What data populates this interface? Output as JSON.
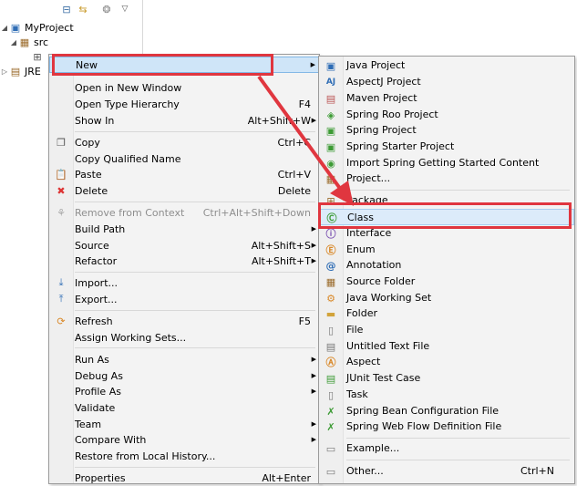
{
  "explorer": {
    "project": "MyProject",
    "src": "src",
    "jre": "JRE"
  },
  "menu": {
    "new": {
      "label": "New"
    },
    "open_new_window": {
      "label": "Open in New Window"
    },
    "open_type_hierarchy": {
      "label": "Open Type Hierarchy",
      "shortcut": "F4"
    },
    "show_in": {
      "label": "Show In",
      "shortcut": "Alt+Shift+W"
    },
    "copy": {
      "label": "Copy",
      "shortcut": "Ctrl+C"
    },
    "copy_qualified": {
      "label": "Copy Qualified Name"
    },
    "paste": {
      "label": "Paste",
      "shortcut": "Ctrl+V"
    },
    "delete": {
      "label": "Delete",
      "shortcut": "Delete"
    },
    "remove_context": {
      "label": "Remove from Context",
      "shortcut": "Ctrl+Alt+Shift+Down"
    },
    "build_path": {
      "label": "Build Path"
    },
    "source": {
      "label": "Source",
      "shortcut": "Alt+Shift+S"
    },
    "refactor": {
      "label": "Refactor",
      "shortcut": "Alt+Shift+T"
    },
    "import": {
      "label": "Import..."
    },
    "export": {
      "label": "Export..."
    },
    "refresh": {
      "label": "Refresh",
      "shortcut": "F5"
    },
    "assign_working_sets": {
      "label": "Assign Working Sets..."
    },
    "run_as": {
      "label": "Run As"
    },
    "debug_as": {
      "label": "Debug As"
    },
    "profile_as": {
      "label": "Profile As"
    },
    "validate": {
      "label": "Validate"
    },
    "team": {
      "label": "Team"
    },
    "compare_with": {
      "label": "Compare With"
    },
    "restore_history": {
      "label": "Restore from Local History..."
    },
    "properties": {
      "label": "Properties",
      "shortcut": "Alt+Enter"
    }
  },
  "submenu": {
    "java_project": "Java Project",
    "aspectj_project": "AspectJ Project",
    "maven_project": "Maven Project",
    "spring_roo_project": "Spring Roo Project",
    "spring_project": "Spring Project",
    "spring_starter_project": "Spring Starter Project",
    "import_spring_guide": "Import Spring Getting Started Content",
    "project": "Project...",
    "package": "Package",
    "class": "Class",
    "interface": "Interface",
    "enum": "Enum",
    "annotation": "Annotation",
    "source_folder": "Source Folder",
    "java_working_set": "Java Working Set",
    "folder": "Folder",
    "file": "File",
    "untitled_text_file": "Untitled Text File",
    "aspect": "Aspect",
    "junit_test_case": "JUnit Test Case",
    "task": "Task",
    "spring_bean_config": "Spring Bean Configuration File",
    "spring_web_flow": "Spring Web Flow Definition File",
    "example": "Example...",
    "other": "Other...",
    "other_shortcut": "Ctrl+N"
  },
  "colors": {
    "annotation": "#e0363f",
    "highlight": "#cfe5f8"
  }
}
